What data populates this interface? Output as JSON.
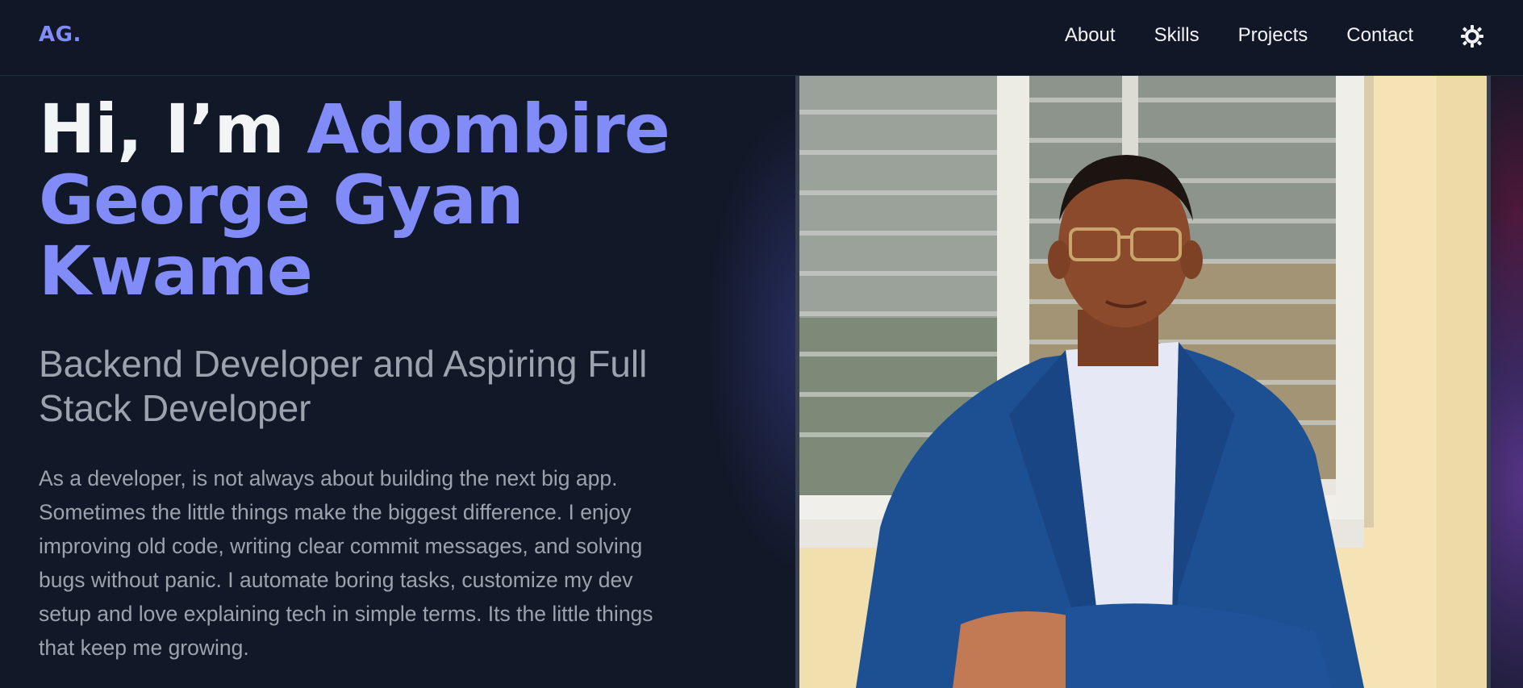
{
  "header": {
    "logo": "AG.",
    "nav": [
      {
        "label": "About"
      },
      {
        "label": "Skills"
      },
      {
        "label": "Projects"
      },
      {
        "label": "Contact"
      }
    ],
    "theme_toggle_icon": "sun-icon"
  },
  "hero": {
    "greeting": "Hi, I’m ",
    "name": "Adombire George Gyan Kwame",
    "subtitle": "Backend Developer and Aspiring Full Stack Developer",
    "bio": "As a developer, is not always about building the next big app. Sometimes the little things make the biggest difference. I enjoy improving old code, writing clear commit messages, and solving bugs without panic. I automate boring tasks, customize my dev setup and love explaining tech in simple terms. Its the little things that keep me growing."
  },
  "profile_photo": {
    "icon": "portrait-photo"
  },
  "colors": {
    "background": "#111827",
    "accent": "#818cf8",
    "text_primary": "#f3f4f6",
    "text_muted": "#9ca3af"
  }
}
